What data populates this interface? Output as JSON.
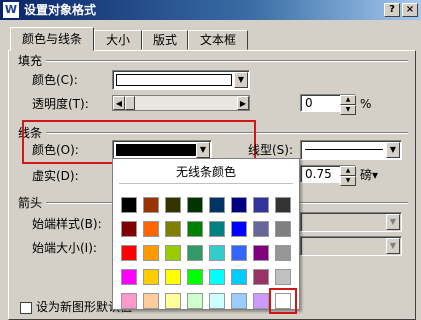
{
  "window": {
    "title": "设置对象格式",
    "app_icon": "W",
    "help_glyph": "?",
    "close_glyph": "×"
  },
  "tabs": [
    {
      "label": "颜色与线条",
      "active": true
    },
    {
      "label": "大小"
    },
    {
      "label": "版式"
    },
    {
      "label": "文本框"
    }
  ],
  "fill": {
    "section_label": "填充",
    "color_label": "颜色(C):",
    "color_value": "#ffffff",
    "transparency_label": "透明度(T):",
    "transparency_value": "0",
    "transparency_unit": "%"
  },
  "line": {
    "section_label": "线条",
    "color_label": "颜色(O):",
    "color_value": "#000000",
    "style_label": "线型(S):",
    "dash_label": "虚实(D):",
    "weight_value": "0.75",
    "weight_unit": "磅▾"
  },
  "arrows": {
    "section_label": "箭头",
    "begin_style_label": "始端样式(B):",
    "begin_size_label": "始端大小(I):"
  },
  "bottom_checkbox": {
    "label": "设为新图形默认值"
  },
  "color_popup": {
    "no_line_label": "无线条颜色",
    "rows": [
      [
        "#000000",
        "#993300",
        "#333300",
        "#003300",
        "#003366",
        "#000080",
        "#333399",
        "#333333"
      ],
      [
        "#800000",
        "#ff6600",
        "#808000",
        "#008000",
        "#008080",
        "#0000ff",
        "#666699",
        "#808080"
      ],
      [
        "#ff0000",
        "#ff9900",
        "#99cc00",
        "#339966",
        "#33cccc",
        "#3366ff",
        "#800080",
        "#969696"
      ],
      [
        "#ff00ff",
        "#ffcc00",
        "#ffff00",
        "#00ff00",
        "#00ffff",
        "#00ccff",
        "#993366",
        "#c0c0c0"
      ],
      [
        "#ff99cc",
        "#ffcc99",
        "#ffff99",
        "#ccffcc",
        "#ccffff",
        "#99ccff",
        "#cc99ff",
        "#ffffff"
      ]
    ],
    "highlighted": "#ffffff",
    "highlight_color": "#d01818"
  }
}
